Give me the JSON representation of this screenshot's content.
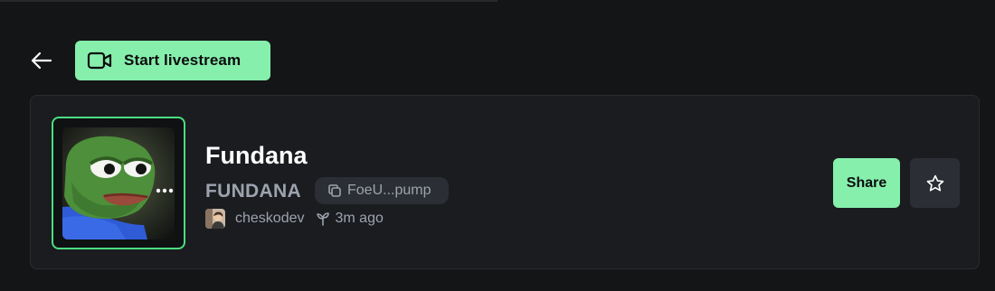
{
  "toolbar": {
    "back_icon": "arrow-left-icon",
    "livestream_label": "Start livestream",
    "livestream_icon": "video-camera-icon",
    "accent": "#86efac"
  },
  "token": {
    "name": "Fundana",
    "ticker": "FUNDANA",
    "address": "FoeU...pump",
    "copy_icon": "copy-icon",
    "creator": "cheskodev",
    "age_icon": "sprout-icon",
    "age": "3m ago",
    "image_icon": "pepe-frog-image"
  },
  "actions": {
    "share_label": "Share",
    "favorite_icon": "star-icon"
  }
}
